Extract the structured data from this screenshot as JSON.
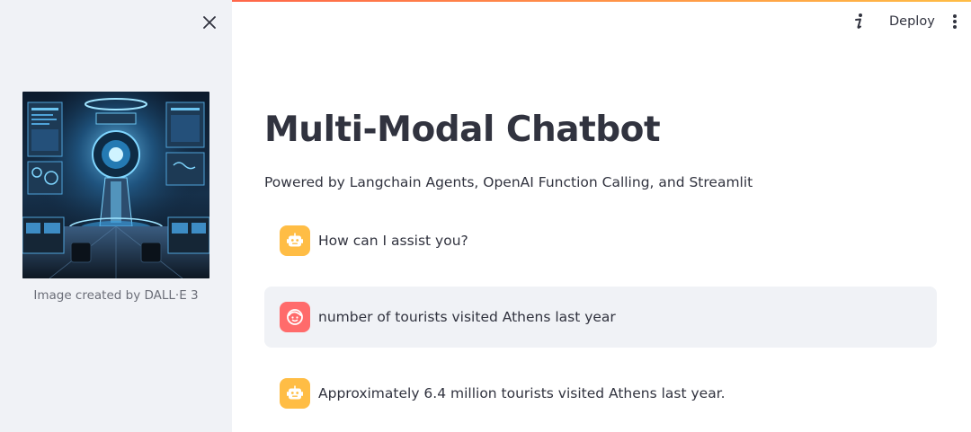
{
  "sidebar": {
    "close_icon": "close-icon",
    "image_caption": "Image created by DALL·E 3"
  },
  "header": {
    "info_icon": "info-icon",
    "deploy_label": "Deploy",
    "menu_icon": "more-vertical-icon"
  },
  "main": {
    "title": "Multi-Modal Chatbot",
    "subtitle": "Powered by Langchain Agents, OpenAI Function Calling, and Streamlit",
    "messages": [
      {
        "role": "assistant",
        "avatar_icon": "robot-icon",
        "text": "How can I assist you?"
      },
      {
        "role": "user",
        "avatar_icon": "face-icon",
        "text": "number of tourists visited Athens last year"
      },
      {
        "role": "assistant",
        "avatar_icon": "robot-icon",
        "text": "Approximately 6.4 million tourists visited Athens last year."
      }
    ]
  },
  "colors": {
    "sidebar_bg": "#f0f2f6",
    "assistant_avatar": "#ffbd45",
    "user_avatar": "#ff6b6b",
    "user_message_bg": "#f0f2f6",
    "text": "#31333f"
  }
}
